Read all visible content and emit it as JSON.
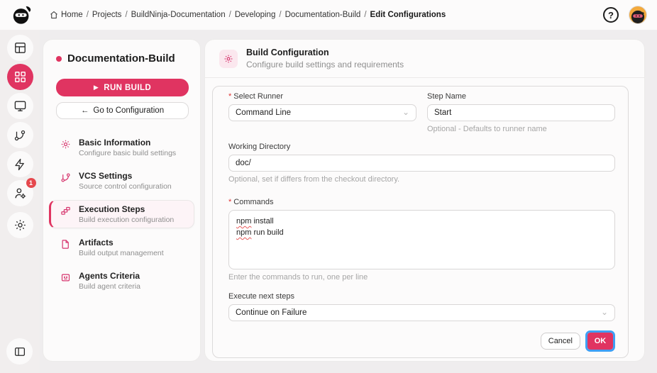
{
  "colors": {
    "accent": "#e03461",
    "focus_ring": "#3f9ff4",
    "badge": "#e5484d"
  },
  "topbar": {
    "breadcrumb": {
      "home": "Home",
      "separator": "/",
      "items": [
        "Projects",
        "BuildNinja-Documentation",
        "Developing",
        "Documentation-Build",
        "Edit Configurations"
      ]
    },
    "help_glyph": "?"
  },
  "rail": {
    "badge_count": "1"
  },
  "sidebar": {
    "title": "Documentation-Build",
    "run_play_glyph": "▶",
    "run_label": "RUN BUILD",
    "goto_arrow_glyph": "←",
    "goto_label": "Go to Configuration",
    "nav": [
      {
        "label": "Basic Information",
        "desc": "Configure basic build settings"
      },
      {
        "label": "VCS Settings",
        "desc": "Source control configuration"
      },
      {
        "label": "Execution Steps",
        "desc": "Build execution configuration"
      },
      {
        "label": "Artifacts",
        "desc": "Build output management"
      },
      {
        "label": "Agents Criteria",
        "desc": "Build agent criteria"
      }
    ]
  },
  "main": {
    "header": {
      "title": "Build Configuration",
      "subtitle": "Configure build settings and requirements"
    },
    "form": {
      "required_marker": "*",
      "chevron_glyph": "⌄",
      "select_runner": {
        "label": "Select Runner",
        "value": "Command Line"
      },
      "step_name": {
        "label": "Step Name",
        "value": "Start",
        "helper": "Optional - Defaults to runner name"
      },
      "working_directory": {
        "label": "Working Directory",
        "value": "doc/",
        "helper": "Optional, set if differs from the checkout directory."
      },
      "commands": {
        "label": "Commands",
        "lines": [
          "npm install",
          "npm run build"
        ],
        "helper": "Enter the commands to run, one per line"
      },
      "execute_next": {
        "label": "Execute next steps",
        "value": "Continue on Failure"
      },
      "cancel_label": "Cancel",
      "ok_label": "OK"
    }
  }
}
